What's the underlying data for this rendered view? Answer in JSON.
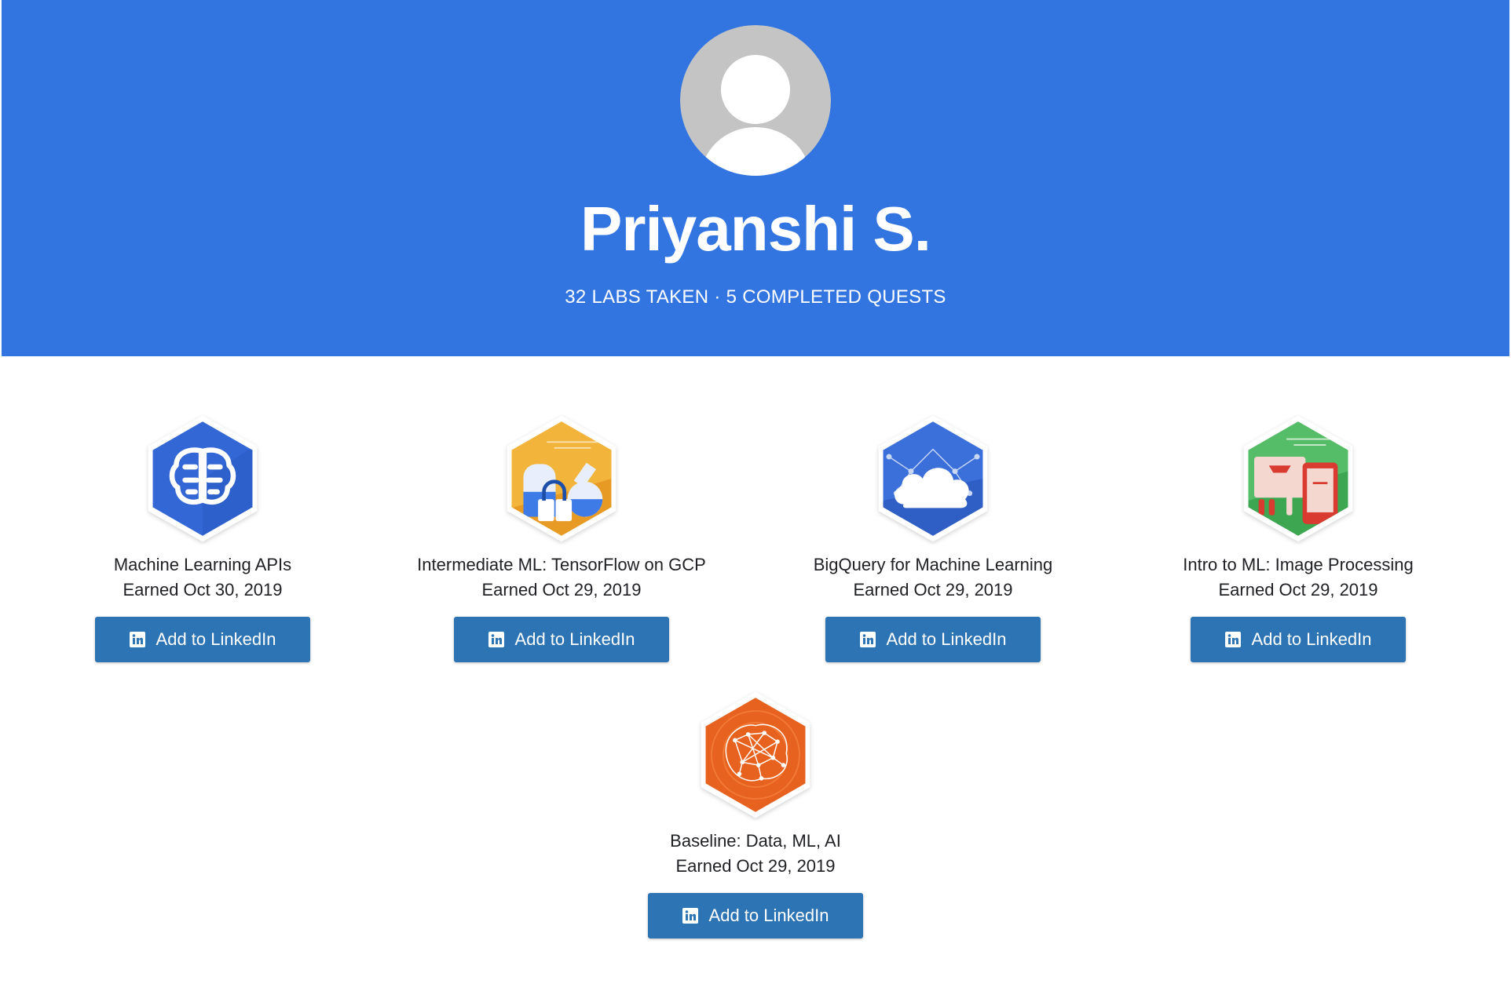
{
  "profile": {
    "name": "Priyanshi S.",
    "stats": "32 LABS TAKEN · 5 COMPLETED QUESTS"
  },
  "colors": {
    "hero_background": "#3275e1",
    "button_background": "#2c74b3"
  },
  "badges": [
    {
      "title": "Machine Learning APIs",
      "date": "Earned Oct 30, 2019",
      "button_label": "Add to LinkedIn",
      "icon": "brain-circuit-icon"
    },
    {
      "title": "Intermediate ML: TensorFlow on GCP",
      "date": "Earned Oct 29, 2019",
      "button_label": "Add to LinkedIn",
      "icon": "lab-flask-icon"
    },
    {
      "title": "BigQuery for Machine Learning",
      "date": "Earned Oct 29, 2019",
      "button_label": "Add to LinkedIn",
      "icon": "cloud-network-icon"
    },
    {
      "title": "Intro to ML: Image Processing",
      "date": "Earned Oct 29, 2019",
      "button_label": "Add to LinkedIn",
      "icon": "image-processing-icon"
    },
    {
      "title": "Baseline: Data, ML, AI",
      "date": "Earned Oct 29, 2019",
      "button_label": "Add to LinkedIn",
      "icon": "neural-brain-icon"
    }
  ]
}
